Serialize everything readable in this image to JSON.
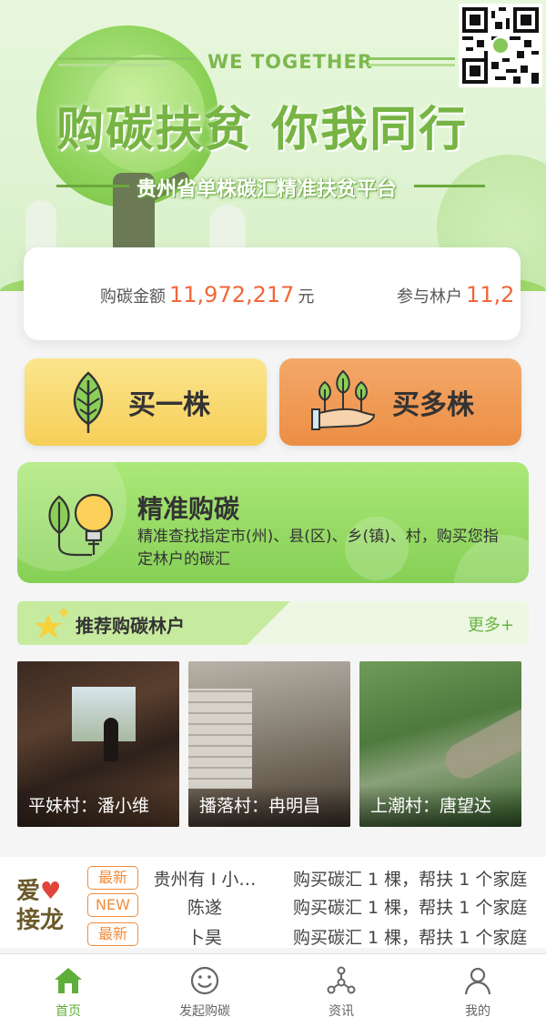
{
  "banner": {
    "we_together": "WE TOGETHER",
    "slogan": "购碳扶贫  你我同行",
    "subtitle": "贵州省单株碳汇精准扶贫平台"
  },
  "stats": {
    "amount_label": "购碳金额",
    "amount_value": "11,972,217",
    "amount_unit": "元",
    "households_label": "参与林户",
    "households_value": "11,2"
  },
  "actions": {
    "buy_one": "买一株",
    "buy_many": "买多株"
  },
  "precise": {
    "title": "精准购碳",
    "desc": "精准查找指定市(州)、县(区)、乡(镇)、村，购买您指定林户的碳汇"
  },
  "recommend": {
    "title": "推荐购碳林户",
    "more": "更多+",
    "items": [
      {
        "caption": "平妹村：潘小维"
      },
      {
        "caption": "播落村：冉明昌"
      },
      {
        "caption": "上潮村：唐望达"
      }
    ]
  },
  "news": {
    "logo_line1": "爱",
    "logo_line2": "接龙",
    "rows": [
      {
        "tag": "最新",
        "who": "贵州有 I 小…",
        "what": "购买碳汇 1 棵，帮扶 1 个家庭"
      },
      {
        "tag": "NEW",
        "who": "陈遂",
        "what": "购买碳汇 1 棵，帮扶 1 个家庭"
      },
      {
        "tag": "最新",
        "who": "卜昊",
        "what": "购买碳汇 1 棵，帮扶 1 个家庭"
      }
    ]
  },
  "tabbar": {
    "items": [
      {
        "label": "首页",
        "icon": "home-icon",
        "active": true
      },
      {
        "label": "发起购碳",
        "icon": "smile-icon",
        "active": false
      },
      {
        "label": "资讯",
        "icon": "share-nodes-icon",
        "active": false
      },
      {
        "label": "我的",
        "icon": "user-icon",
        "active": false
      }
    ]
  },
  "colors": {
    "accent_green": "#5fae3a",
    "number_orange": "#f0673a",
    "tag_orange": "#f08c3c"
  }
}
